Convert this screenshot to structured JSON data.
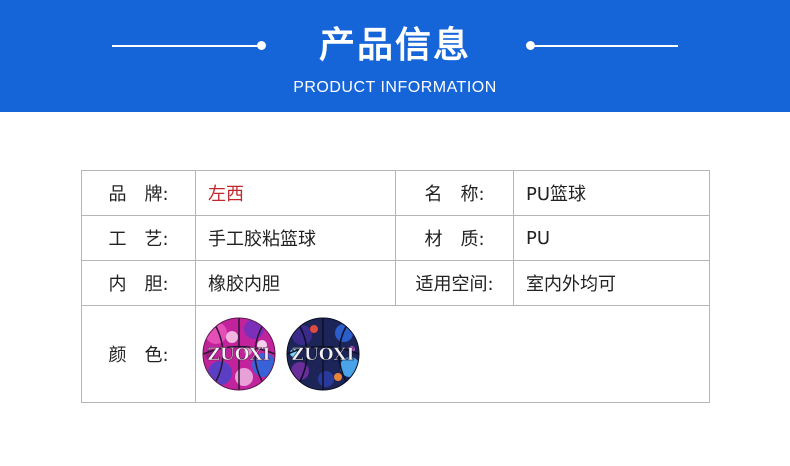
{
  "header": {
    "title": "产品信息",
    "subtitle": "PRODUCT INFORMATION",
    "background_color": "#1565d8"
  },
  "spec_table": {
    "rows": [
      {
        "label1": "品　牌:",
        "value1": "左西",
        "label2": "名　称:",
        "value2": "PU篮球"
      },
      {
        "label1": "工　艺:",
        "value1": "手工胶粘篮球",
        "label2": "材　质:",
        "value2": "PU"
      },
      {
        "label1": "内　胆:",
        "value1": "橡胶内胆",
        "label2": "适用空间:",
        "value2": "室内外均可"
      }
    ],
    "color_row": {
      "label": "颜　色:",
      "swatches": [
        {
          "name": "pink-blue-splatter",
          "lettering": "ZUOXI",
          "base_color": "#c2239c",
          "accent_color": "#3a62d8"
        },
        {
          "name": "navy-multicolor-splatter",
          "lettering": "ZUOXI",
          "base_color": "#1c2458",
          "accent_color": "#4aa2e8"
        }
      ]
    },
    "brand_color": "#c0272d"
  }
}
